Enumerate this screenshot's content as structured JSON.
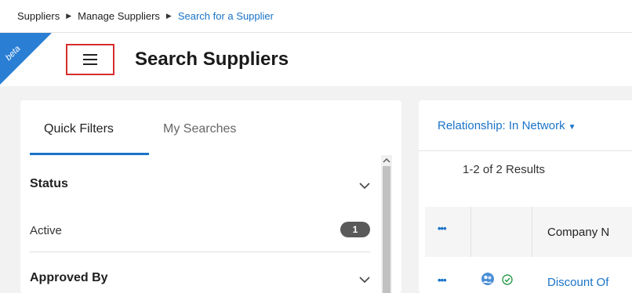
{
  "breadcrumb": {
    "items": [
      "Suppliers",
      "Manage Suppliers",
      "Search for a Supplier"
    ]
  },
  "header": {
    "beta_label": "beta",
    "title": "Search Suppliers",
    "menu_icon": "hamburger-menu-icon"
  },
  "filters": {
    "tabs": [
      {
        "label": "Quick Filters",
        "active": true
      },
      {
        "label": "My Searches",
        "active": false
      }
    ],
    "status": {
      "title": "Status",
      "options": [
        {
          "label": "Active",
          "count": "1"
        }
      ]
    },
    "approved_by": {
      "title": "Approved By"
    }
  },
  "results": {
    "relationship_filter": "Relationship: In Network",
    "count_text": "1-2 of 2 Results",
    "table": {
      "actions_glyph": "•••",
      "columns": [
        "Company N"
      ],
      "rows": [
        {
          "actions_glyph": "•••",
          "company": "Discount Of",
          "icons": [
            "supplier-group-icon",
            "verified-check-icon"
          ]
        }
      ]
    }
  },
  "colors": {
    "accent": "#1a73c8",
    "beta_ribbon": "#2a7fd4",
    "highlight_border": "#d62e2e",
    "badge": "#5a5a5a",
    "verified": "#2e9e4f"
  }
}
